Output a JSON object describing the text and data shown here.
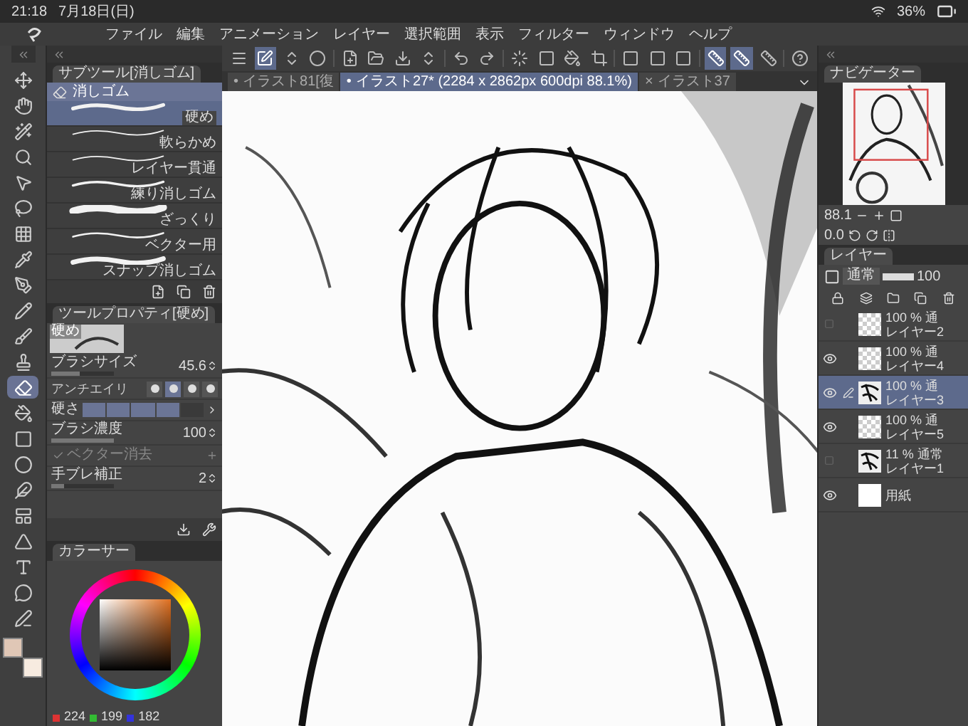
{
  "status_bar": {
    "time": "21:18",
    "date": "7月18日(日)",
    "battery": "36%"
  },
  "menu": [
    "ファイル",
    "編集",
    "アニメーション",
    "レイヤー",
    "選択範囲",
    "表示",
    "フィルター",
    "ウィンドウ",
    "ヘルプ"
  ],
  "toolbar": [
    [
      {
        "kind": "menu",
        "on": false
      },
      {
        "kind": "edit",
        "on": true
      },
      {
        "kind": "updown",
        "on": false
      },
      {
        "kind": "quick",
        "on": false
      }
    ],
    [
      {
        "kind": "new",
        "on": false
      },
      {
        "kind": "open",
        "on": false
      },
      {
        "kind": "save",
        "on": false
      },
      {
        "kind": "updown",
        "on": false
      }
    ],
    [
      {
        "kind": "undo",
        "on": false
      },
      {
        "kind": "redo",
        "on": false
      }
    ],
    [
      {
        "kind": "deselect",
        "on": false
      },
      {
        "kind": "square",
        "on": false
      },
      {
        "kind": "fill",
        "on": false
      },
      {
        "kind": "crop",
        "on": false
      }
    ],
    [
      {
        "kind": "square",
        "on": false
      },
      {
        "kind": "square",
        "on": false
      },
      {
        "kind": "square",
        "on": false
      }
    ],
    [
      {
        "kind": "ruler",
        "on": true
      },
      {
        "kind": "ruler",
        "on": true
      },
      {
        "kind": "ruler",
        "on": false
      }
    ],
    [
      {
        "kind": "help",
        "on": false
      }
    ]
  ],
  "document_tabs": [
    {
      "mark": "•",
      "label": "イラスト81[復",
      "selected": false
    },
    {
      "mark": "•",
      "label": "イラスト27* (2284 x 2862px 600dpi 88.1%)",
      "selected": true
    },
    {
      "mark": "×",
      "label": "イラスト37",
      "selected": false
    }
  ],
  "tools": [
    {
      "kind": "move",
      "selected": false
    },
    {
      "kind": "hand",
      "selected": false
    },
    {
      "kind": "wand",
      "selected": false
    },
    {
      "kind": "zoom",
      "selected": false
    },
    {
      "kind": "pointer",
      "selected": false
    },
    {
      "kind": "lasso",
      "selected": false
    },
    {
      "kind": "grid",
      "selected": false
    },
    {
      "kind": "eyedropper",
      "selected": false
    },
    {
      "kind": "pen",
      "selected": false
    },
    {
      "kind": "pencil",
      "selected": false
    },
    {
      "kind": "brush",
      "selected": false
    },
    {
      "kind": "stamp",
      "selected": false
    },
    {
      "kind": "eraser",
      "selected": true
    },
    {
      "kind": "fill",
      "selected": false
    },
    {
      "kind": "gradient",
      "selected": false
    },
    {
      "kind": "circle",
      "selected": false
    },
    {
      "kind": "feather",
      "selected": false
    },
    {
      "kind": "frame",
      "selected": false
    },
    {
      "kind": "triangle",
      "selected": false
    },
    {
      "kind": "text",
      "selected": false
    },
    {
      "kind": "balloon",
      "selected": false
    },
    {
      "kind": "line",
      "selected": false
    }
  ],
  "sub_tool": {
    "title": "サブツール[消しゴム]",
    "group": "消しゴム",
    "items": [
      {
        "label": "硬め",
        "selected": true
      },
      {
        "label": "軟らかめ",
        "selected": false
      },
      {
        "label": "レイヤー貫通",
        "selected": false
      },
      {
        "label": "練り消しゴム",
        "selected": false
      },
      {
        "label": "ざっくり",
        "selected": false
      },
      {
        "label": "ベクター用",
        "selected": false
      },
      {
        "label": "スナップ消しゴム",
        "selected": false
      }
    ]
  },
  "tool_property": {
    "title": "ツールプロパティ[硬め]",
    "preview_label": "硬め",
    "rows": [
      {
        "kind": "slider",
        "label": "ブラシサイズ",
        "value": "45.6",
        "level": 0.45
      },
      {
        "kind": "choice",
        "label": "アンチエイリ",
        "options": [
          {
            "selected": false
          },
          {
            "selected": true
          },
          {
            "selected": false
          },
          {
            "selected": false
          }
        ]
      },
      {
        "kind": "segments",
        "label": "硬さ",
        "level": 0.8
      },
      {
        "kind": "slider",
        "label": "ブラシ濃度",
        "value": "100",
        "level": 1
      },
      {
        "kind": "toggle",
        "label": "ベクター消去",
        "checked": true,
        "disabled": true
      },
      {
        "kind": "slider",
        "label": "手ブレ補正",
        "value": "2",
        "level": 0.2
      }
    ]
  },
  "color_panel": {
    "title": "カラーサー",
    "rgb": [
      "224",
      "199",
      "182"
    ]
  },
  "navigator": {
    "title": "ナビゲーター",
    "zoom": "88.1",
    "rotation": "0.0"
  },
  "layer_panel": {
    "title": "レイヤー",
    "blend": "通常",
    "opacity": "100",
    "layers": [
      {
        "info": "100 % 通",
        "name": "レイヤー2",
        "visible": false,
        "selected": false,
        "kind": "transparent"
      },
      {
        "info": "100 % 通",
        "name": "レイヤー4",
        "visible": true,
        "selected": false,
        "kind": "transparent"
      },
      {
        "info": "100 % 通",
        "name": "レイヤー3",
        "visible": true,
        "selected": true,
        "kind": "sketch"
      },
      {
        "info": "100 % 通",
        "name": "レイヤー5",
        "visible": true,
        "selected": false,
        "kind": "transparent"
      },
      {
        "info": "11 % 通常",
        "name": "レイヤー1",
        "visible": false,
        "selected": false,
        "kind": "sketch"
      },
      {
        "name": "用紙",
        "visible": true,
        "selected": false,
        "kind": "paper"
      }
    ]
  }
}
